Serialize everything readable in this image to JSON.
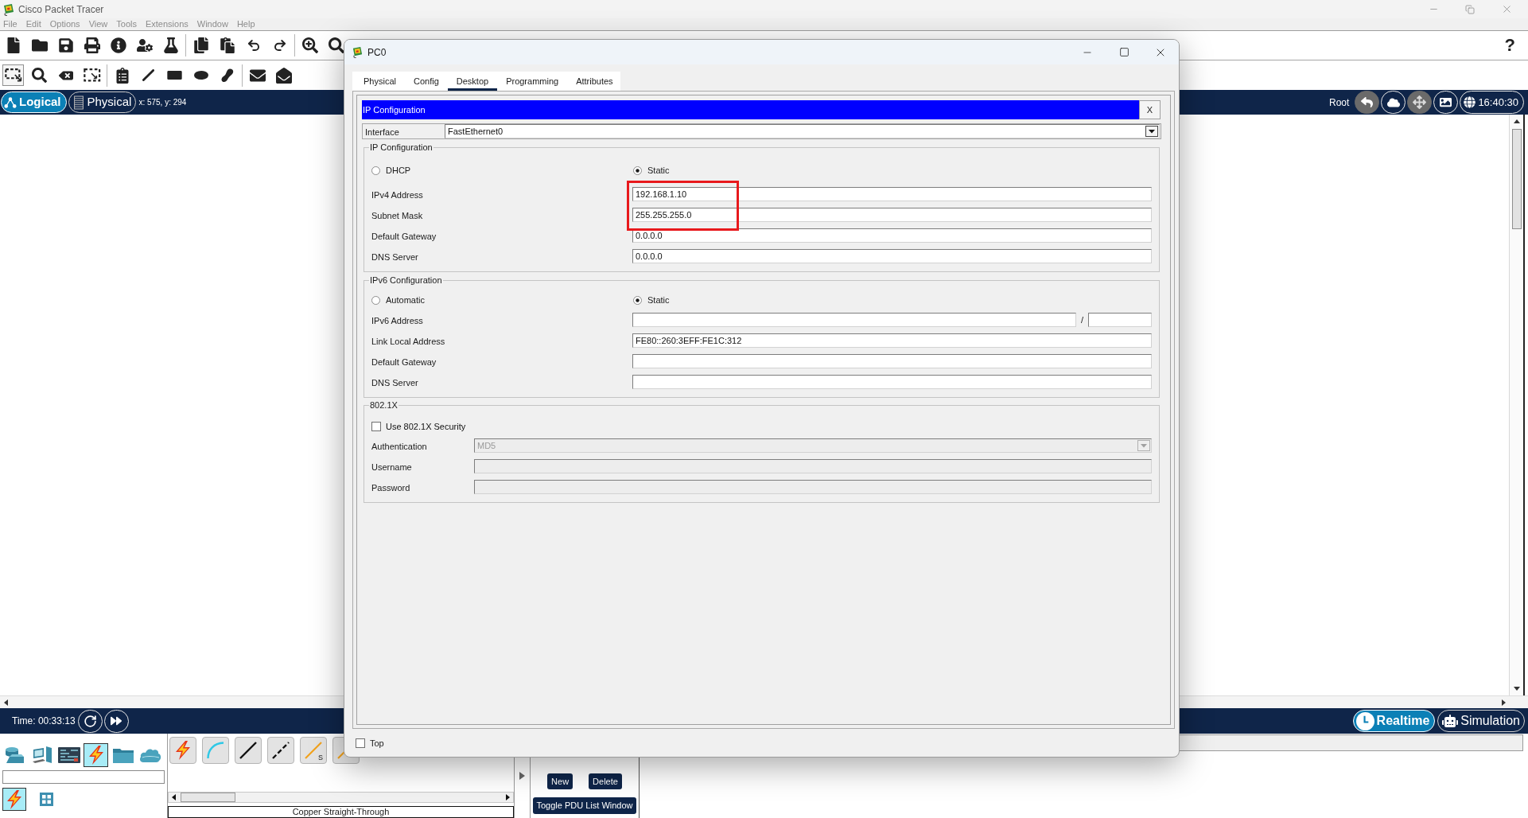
{
  "window": {
    "title": "Cisco Packet Tracer"
  },
  "menu": [
    "File",
    "Edit",
    "Options",
    "View",
    "Tools",
    "Extensions",
    "Window",
    "Help"
  ],
  "toolbar": {
    "help": "?"
  },
  "edit_tools": [
    {
      "selected": true
    },
    {
      "selected": false
    },
    {
      "selected": false
    },
    {
      "selected": false
    }
  ],
  "workspace_bar": {
    "views": [
      {
        "label": "Logical",
        "selected": true
      },
      {
        "label": "Physical",
        "selected": false
      }
    ],
    "coordinates": "x: 575, y: 294",
    "location": "Root",
    "clock": "16:40:30"
  },
  "dialog": {
    "title": "PC0",
    "tabs": [
      {
        "label": "Physical",
        "selected": false
      },
      {
        "label": "Config",
        "selected": false
      },
      {
        "label": "Desktop",
        "selected": true
      },
      {
        "label": "Programming",
        "selected": false
      },
      {
        "label": "Attributes",
        "selected": false
      }
    ],
    "app_title": "IP Configuration",
    "close_label": "X",
    "interface": {
      "label": "Interface",
      "value": "FastEthernet0"
    },
    "ipv4": {
      "legend": "IP Configuration",
      "modes": [
        {
          "label": "DHCP",
          "selected": false
        },
        {
          "label": "Static",
          "selected": true
        }
      ],
      "fields": [
        {
          "label": "IPv4 Address",
          "value": "192.168.1.10",
          "highlighted": true
        },
        {
          "label": "Subnet Mask",
          "value": "255.255.255.0",
          "highlighted": true
        },
        {
          "label": "Default Gateway",
          "value": "0.0.0.0",
          "highlighted": false
        },
        {
          "label": "DNS Server",
          "value": "0.0.0.0",
          "highlighted": false
        }
      ]
    },
    "ipv6": {
      "legend": "IPv6 Configuration",
      "modes": [
        {
          "label": "Automatic",
          "selected": false
        },
        {
          "label": "Static",
          "selected": true
        }
      ],
      "fields": [
        {
          "kind": "prefixed",
          "label": "IPv6 Address",
          "separator": "/"
        },
        {
          "kind": "text",
          "label": "Link Local Address",
          "value": "FE80::260:3EFF:FE1C:312"
        },
        {
          "kind": "text",
          "label": "Default Gateway"
        },
        {
          "kind": "text",
          "label": "DNS Server"
        }
      ]
    },
    "security": {
      "legend": "802.1X",
      "items": [
        {
          "kind": "checkbox",
          "label": "Use 802.1X Security",
          "checked": false,
          "disabled": false
        },
        {
          "kind": "select",
          "label": "Authentication",
          "value": "MD5",
          "disabled": true
        },
        {
          "kind": "text",
          "label": "Username",
          "disabled": true
        },
        {
          "kind": "text",
          "label": "Password",
          "disabled": true
        }
      ]
    },
    "top_option": {
      "label": "Top",
      "checked": false
    }
  },
  "simulation_bar": {
    "time": "Time: 00:33:13",
    "modes": [
      {
        "label": "Realtime",
        "selected": true
      },
      {
        "label": "Simulation",
        "selected": false
      }
    ]
  },
  "device_categories": [
    {
      "selected": false
    },
    {
      "selected": false
    },
    {
      "selected": false
    },
    {
      "selected": true
    },
    {
      "selected": false
    },
    {
      "selected": false
    }
  ],
  "device_types": [
    {
      "selected": true
    },
    {
      "selected": false
    }
  ],
  "cables": [
    {
      "kind": "auto"
    },
    {
      "kind": "console"
    },
    {
      "kind": "straight"
    },
    {
      "kind": "crossover"
    },
    {
      "kind": "serial",
      "tag": "S"
    },
    {
      "kind": "serial"
    }
  ],
  "cable_name": "Copper Straight-Through",
  "pdu_buttons": [
    "New",
    "Delete",
    "Toggle PDU List Window"
  ]
}
